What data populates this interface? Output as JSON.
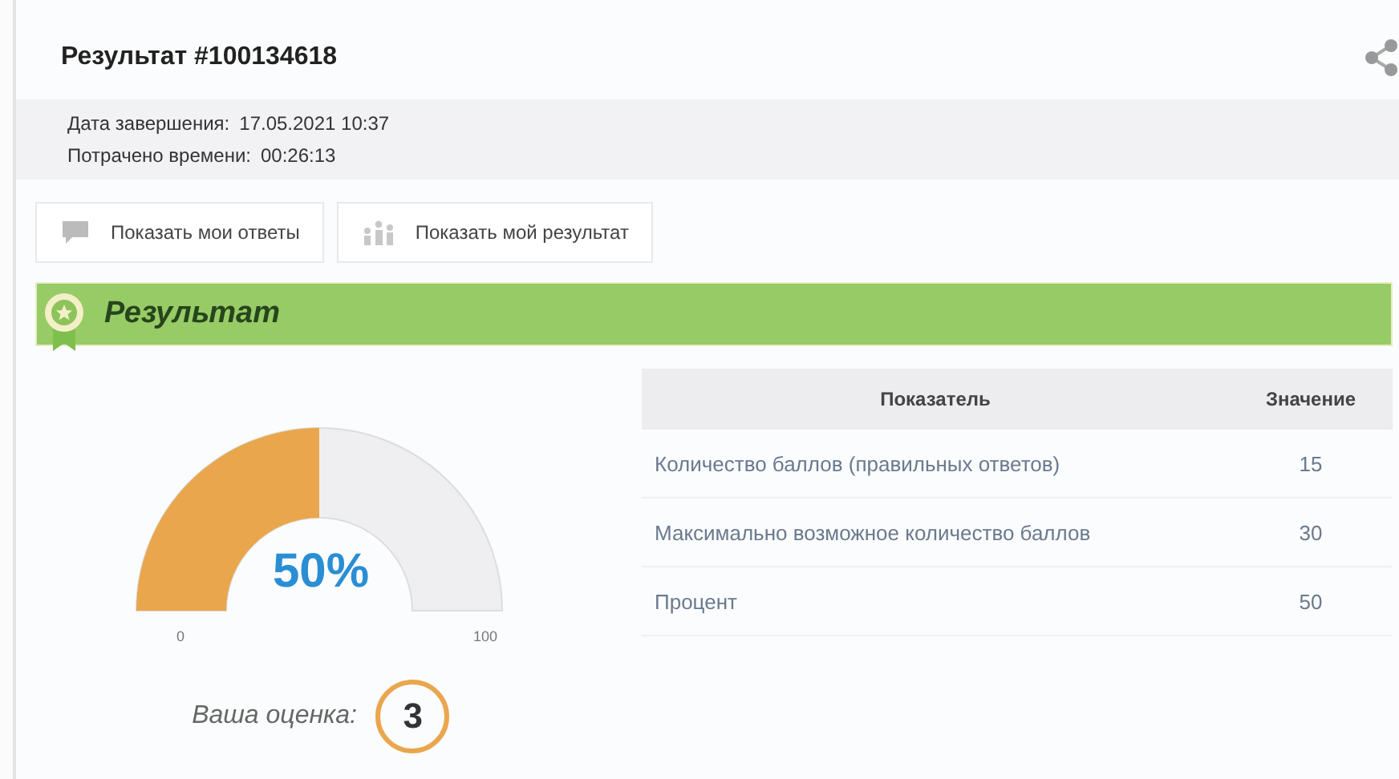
{
  "title": "Результат #100134618",
  "info": [
    {
      "label": "Дата завершения:",
      "value": "17.05.2021 10:37"
    },
    {
      "label": "Потрачено времени:",
      "value": "00:26:13"
    }
  ],
  "buttons": [
    {
      "kind": "answers",
      "label": "Показать мои ответы"
    },
    {
      "kind": "result",
      "label": "Показать мой результат"
    }
  ],
  "section_title": "Результат",
  "gauge": {
    "level": 0.5,
    "value_text": "50%",
    "min_label": "0",
    "max_label": "100"
  },
  "grade": {
    "label": "Ваша оценка:",
    "value": "3"
  },
  "table": {
    "columns": [
      "Показатель",
      "Значение"
    ],
    "rows": [
      [
        "Количество баллов (правильных ответов)",
        "15"
      ],
      [
        "Максимально возможное количество баллов",
        "30"
      ],
      [
        "Процент",
        "50"
      ]
    ]
  }
}
